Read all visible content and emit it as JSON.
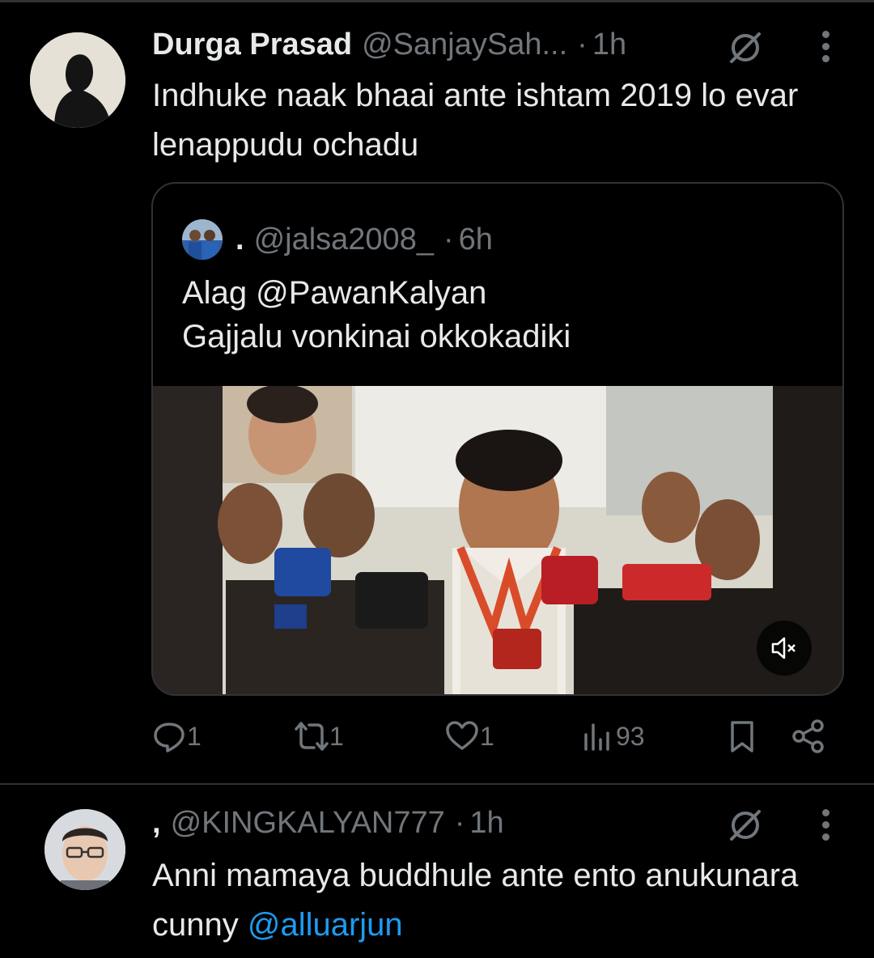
{
  "reply1": {
    "display_name": "Durga Prasad",
    "handle": "@SanjaySah...",
    "separator": "·",
    "time": "1h",
    "text": "Indhuke naak bhaai ante ishtam 2019 lo evar lenappudu ochadu",
    "quoted": {
      "display_name": ".",
      "handle": "@jalsa2008_",
      "separator": "·",
      "time": "6h",
      "line1": "Alag @PawanKalyan",
      "line2": "Gajjalu vonkinai okkokadiki"
    },
    "actions": {
      "replies": "1",
      "reposts": "1",
      "likes": "1",
      "views": "93"
    }
  },
  "reply2": {
    "display_name": ",",
    "handle": "@KINGKALYAN777",
    "separator": "·",
    "time": "1h",
    "text": "Anni mamaya buddhule ante ento anukunara cunny ",
    "mention": "@alluarjun"
  },
  "colors": {
    "background": "#000000",
    "text": "#e7e9ea",
    "muted": "#71767b",
    "link": "#1d9bf0",
    "divider": "#2f3336"
  },
  "icons": [
    "grok-icon",
    "more-icon",
    "reply-icon",
    "repost-icon",
    "like-icon",
    "views-icon",
    "bookmark-icon",
    "share-icon",
    "mute-icon"
  ]
}
